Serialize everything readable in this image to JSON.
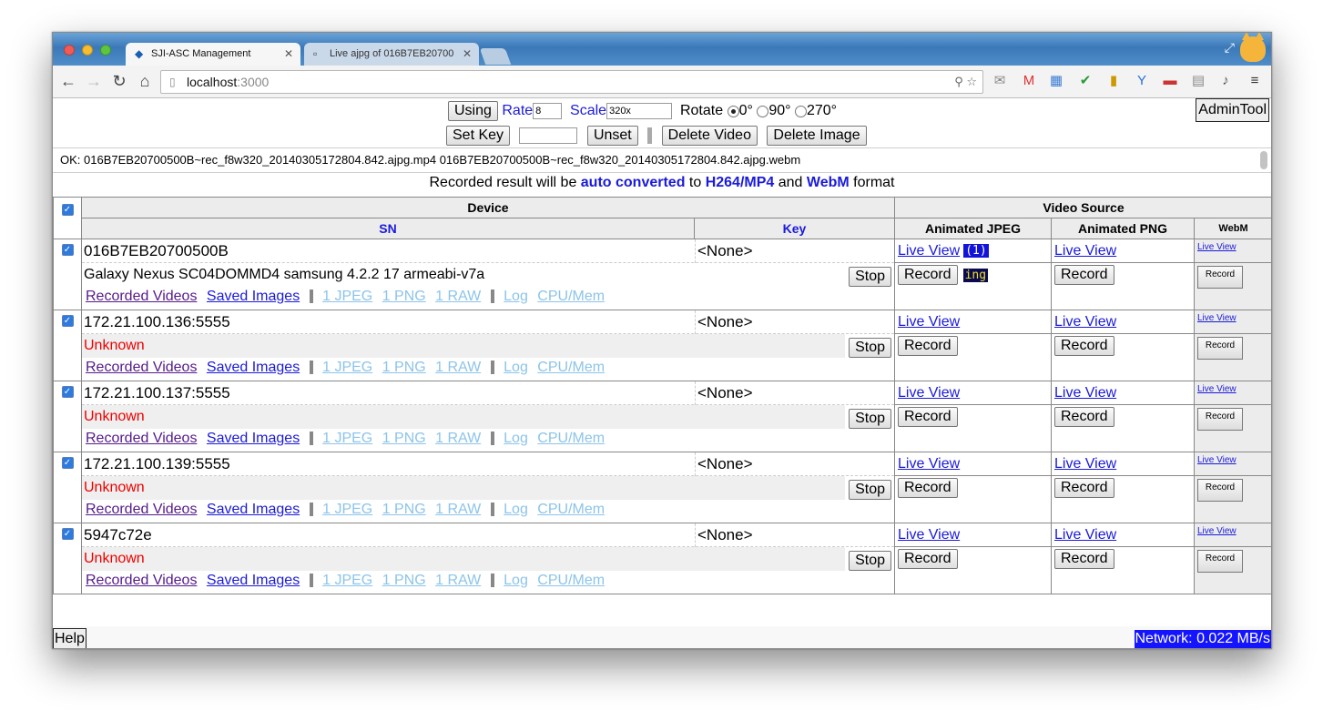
{
  "browser": {
    "tabs": [
      {
        "title": "SJI-ASC Management",
        "active": true
      },
      {
        "title": "Live ajpg of 016B7EB20700",
        "active": false
      }
    ],
    "url_host": "localhost",
    "url_port": ":3000"
  },
  "controls": {
    "using_label": "Using",
    "rate_label": "Rate",
    "rate_value": "8",
    "scale_label": "Scale",
    "scale_value": "320x",
    "rotate_label": "Rotate",
    "rotate_options": [
      "0°",
      "90°",
      "270°"
    ],
    "set_key_label": "Set Key",
    "key_value": "",
    "unset_label": "Unset",
    "delete_video_label": "Delete Video",
    "delete_image_label": "Delete Image",
    "admin_label": "AdminTool"
  },
  "status_message": "OK: 016B7EB20700500B~rec_f8w320_20140305172804.842.ajpg.mp4 016B7EB20700500B~rec_f8w320_20140305172804.842.ajpg.webm",
  "notice": {
    "p1": "Recorded result will be ",
    "b1": "auto converted",
    "p2": " to ",
    "b2": "H264/MP4",
    "p3": " and ",
    "b3": "WebM",
    "p4": " format"
  },
  "table": {
    "device_header": "Device",
    "video_source_header": "Video Source",
    "sn_header": "SN",
    "key_header": "Key",
    "ajpeg_header": "Animated JPEG",
    "apng_header": "Animated PNG",
    "webm_header": "WebM"
  },
  "labels": {
    "live_view": "Live View",
    "record": "Record",
    "stop": "Stop",
    "recorded_videos": "Recorded Videos",
    "saved_images": "Saved Images",
    "jpeg": "1 JPEG",
    "png": "1 PNG",
    "raw": "1 RAW",
    "log": "Log",
    "cpu_mem": "CPU/Mem"
  },
  "devices": [
    {
      "sn": "016B7EB20700500B",
      "key": "<None>",
      "info": "Galaxy Nexus SC04DOMMD4 samsung 4.2.2 17 armeabi-v7a",
      "unknown": false,
      "badge": "(1)",
      "recording": "ing"
    },
    {
      "sn": "172.21.100.136:5555",
      "key": "<None>",
      "info": "Unknown",
      "unknown": true
    },
    {
      "sn": "172.21.100.137:5555",
      "key": "<None>",
      "info": "Unknown",
      "unknown": true
    },
    {
      "sn": "172.21.100.139:5555",
      "key": "<None>",
      "info": "Unknown",
      "unknown": true
    },
    {
      "sn": "5947c72e",
      "key": "<None>",
      "info": "Unknown",
      "unknown": true
    }
  ],
  "footer": {
    "help_label": "Help",
    "network_status": "Network: 0.022 MB/s"
  },
  "colors": {
    "link_blue": "#1a1adc",
    "unknown_red": "#ee0000",
    "badge_bg": "#1414d8",
    "network_bg": "#1414ff"
  }
}
